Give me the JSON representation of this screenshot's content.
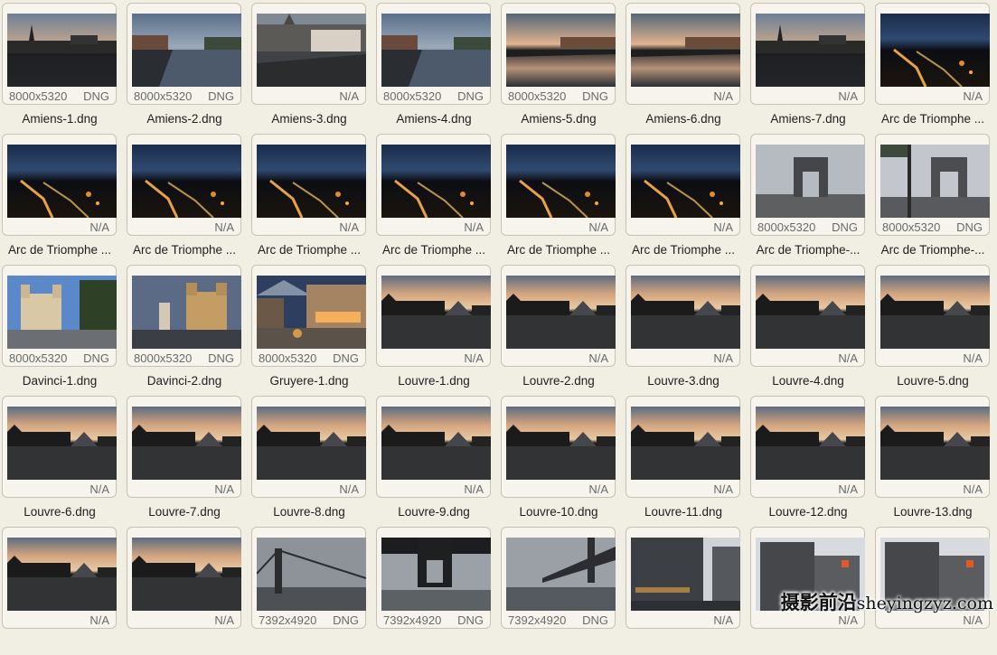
{
  "files": [
    {
      "name": "Amiens-1.dng",
      "dims": "8000x5320",
      "format": "DNG",
      "scene": "amiens-dusk"
    },
    {
      "name": "Amiens-2.dng",
      "dims": "8000x5320",
      "format": "DNG",
      "scene": "amiens-canal"
    },
    {
      "name": "Amiens-3.dng",
      "dims": "",
      "format": "N/A",
      "scene": "amiens-cathedral"
    },
    {
      "name": "Amiens-4.dng",
      "dims": "8000x5320",
      "format": "DNG",
      "scene": "amiens-canal"
    },
    {
      "name": "Amiens-5.dng",
      "dims": "8000x5320",
      "format": "DNG",
      "scene": "amiens-sunset"
    },
    {
      "name": "Amiens-6.dng",
      "dims": "",
      "format": "N/A",
      "scene": "amiens-sunset"
    },
    {
      "name": "Amiens-7.dng",
      "dims": "",
      "format": "N/A",
      "scene": "amiens-dusk"
    },
    {
      "name": "Arc de Triomphe ...",
      "dims": "",
      "format": "N/A",
      "scene": "arc-night"
    },
    {
      "name": "Arc de Triomphe ...",
      "dims": "",
      "format": "N/A",
      "scene": "arc-night"
    },
    {
      "name": "Arc de Triomphe ...",
      "dims": "",
      "format": "N/A",
      "scene": "arc-night"
    },
    {
      "name": "Arc de Triomphe ...",
      "dims": "",
      "format": "N/A",
      "scene": "arc-night"
    },
    {
      "name": "Arc de Triomphe ...",
      "dims": "",
      "format": "N/A",
      "scene": "arc-night"
    },
    {
      "name": "Arc de Triomphe ...",
      "dims": "",
      "format": "N/A",
      "scene": "arc-night"
    },
    {
      "name": "Arc de Triomphe ...",
      "dims": "",
      "format": "N/A",
      "scene": "arc-night"
    },
    {
      "name": "Arc de Triomphe-...",
      "dims": "8000x5320",
      "format": "DNG",
      "scene": "arc-day"
    },
    {
      "name": "Arc de Triomphe-...",
      "dims": "8000x5320",
      "format": "DNG",
      "scene": "arc-lamp"
    },
    {
      "name": "Davinci-1.dng",
      "dims": "8000x5320",
      "format": "DNG",
      "scene": "church-blue"
    },
    {
      "name": "Davinci-2.dng",
      "dims": "8000x5320",
      "format": "DNG",
      "scene": "church-dusk"
    },
    {
      "name": "Gruyere-1.dng",
      "dims": "8000x5320",
      "format": "DNG",
      "scene": "village"
    },
    {
      "name": "Louvre-1.dng",
      "dims": "",
      "format": "N/A",
      "scene": "louvre"
    },
    {
      "name": "Louvre-2.dng",
      "dims": "",
      "format": "N/A",
      "scene": "louvre"
    },
    {
      "name": "Louvre-3.dng",
      "dims": "",
      "format": "N/A",
      "scene": "louvre"
    },
    {
      "name": "Louvre-4.dng",
      "dims": "",
      "format": "N/A",
      "scene": "louvre"
    },
    {
      "name": "Louvre-5.dng",
      "dims": "",
      "format": "N/A",
      "scene": "louvre"
    },
    {
      "name": "Louvre-6.dng",
      "dims": "",
      "format": "N/A",
      "scene": "louvre"
    },
    {
      "name": "Louvre-7.dng",
      "dims": "",
      "format": "N/A",
      "scene": "louvre"
    },
    {
      "name": "Louvre-8.dng",
      "dims": "",
      "format": "N/A",
      "scene": "louvre"
    },
    {
      "name": "Louvre-9.dng",
      "dims": "",
      "format": "N/A",
      "scene": "louvre"
    },
    {
      "name": "Louvre-10.dng",
      "dims": "",
      "format": "N/A",
      "scene": "louvre"
    },
    {
      "name": "Louvre-11.dng",
      "dims": "",
      "format": "N/A",
      "scene": "louvre"
    },
    {
      "name": "Louvre-12.dng",
      "dims": "",
      "format": "N/A",
      "scene": "louvre"
    },
    {
      "name": "Louvre-13.dng",
      "dims": "",
      "format": "N/A",
      "scene": "louvre"
    },
    {
      "name": "",
      "dims": "",
      "format": "N/A",
      "scene": "louvre"
    },
    {
      "name": "",
      "dims": "",
      "format": "N/A",
      "scene": "louvre"
    },
    {
      "name": "",
      "dims": "7392x4920",
      "format": "DNG",
      "scene": "bridge-side"
    },
    {
      "name": "",
      "dims": "7392x4920",
      "format": "DNG",
      "scene": "bridge-under"
    },
    {
      "name": "",
      "dims": "7392x4920",
      "format": "DNG",
      "scene": "bridge-angle"
    },
    {
      "name": "",
      "dims": "",
      "format": "N/A",
      "scene": "nyc-street"
    },
    {
      "name": "",
      "dims": "",
      "format": "N/A",
      "scene": "nyc-building"
    },
    {
      "name": "",
      "dims": "",
      "format": "N/A",
      "scene": "nyc-building"
    }
  ],
  "watermark": {
    "brand": "摄影前沿",
    "domain": "sheyingzyz.com"
  }
}
